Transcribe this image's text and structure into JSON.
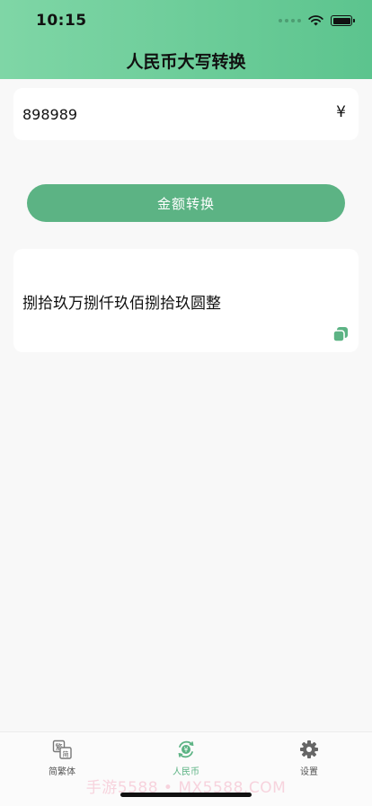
{
  "status_bar": {
    "time": "10:15"
  },
  "header": {
    "title": "人民币大写转换"
  },
  "input": {
    "value": "898989",
    "currency_symbol": "¥"
  },
  "convert_button": {
    "label": "金额转换"
  },
  "result": {
    "text": "捌拾玖万捌仟玖佰捌拾玖圆整"
  },
  "tabbar": {
    "tabs": [
      {
        "label": "简繁体",
        "icon": "traditional-simplified-icon",
        "active": false
      },
      {
        "label": "人民币",
        "icon": "rmb-convert-icon",
        "active": true
      },
      {
        "label": "设置",
        "icon": "gear-icon",
        "active": false
      }
    ]
  },
  "watermark": "手游5588 • MX5588.COM",
  "colors": {
    "accent": "#5cb384",
    "header_start": "#7fd6a6",
    "header_end": "#5cc48e",
    "background": "#f8f8f8"
  }
}
